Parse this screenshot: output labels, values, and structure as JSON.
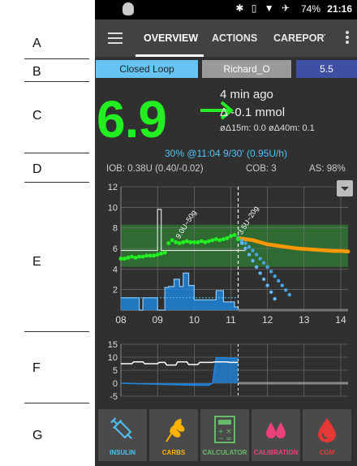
{
  "annotations": [
    "A",
    "B",
    "C",
    "D",
    "E",
    "F",
    "G"
  ],
  "status_bar": {
    "time": "21:16",
    "battery": "74%",
    "icons": "✱ ▯ ▼ ✈"
  },
  "toolbar": {
    "tabs": [
      {
        "label": "OVERVIEW",
        "active": true
      },
      {
        "label": "ACTIONS",
        "active": false
      },
      {
        "label": "CAREPORT",
        "active": false
      }
    ]
  },
  "top_buttons": {
    "loop_mode": "Closed Loop",
    "profile": "Richard_O",
    "target": "5.5"
  },
  "bg": {
    "value": "6.9",
    "trend_arrow": "→",
    "ago": "4 min ago",
    "delta": "Δ -0.1 mmol",
    "avg_delta": "øΔ15m: 0.0  øΔ40m: 0.1",
    "color": "#22ee22"
  },
  "temp_basal": "30% @11:04 9/30' (0.95U/h)",
  "iob_cob": {
    "iob": "IOB: 0.38U (0.40/-0.02)",
    "cob": "COB: 3",
    "as": "AS: 98%"
  },
  "colors": {
    "bg_point": "#22ee22",
    "prediction_iob": "#4aa3df",
    "prediction_cob": "#ff9800",
    "basal": "#1e88e5",
    "target_band": "#2e7d32"
  },
  "chart_data": [
    {
      "type": "line",
      "title": "",
      "x_tick_labels": [
        "08",
        "09",
        "10",
        "11",
        "12",
        "13",
        "14"
      ],
      "y_tick_labels": [
        "2",
        "4",
        "6",
        "8",
        "10",
        "12"
      ],
      "ylim": [
        0,
        12
      ],
      "xlim": [
        8.0,
        14.2
      ],
      "target_range": [
        4.2,
        8.3
      ],
      "now": 11.2,
      "bg": {
        "x": [
          8.0,
          8.1,
          8.2,
          8.3,
          8.4,
          8.5,
          8.6,
          8.7,
          8.8,
          8.9,
          9.0,
          9.1,
          9.2,
          9.3,
          9.4,
          9.5,
          9.6,
          9.7,
          9.8,
          9.9,
          10.0,
          10.1,
          10.2,
          10.3,
          10.4,
          10.5,
          10.6,
          10.7,
          10.8,
          10.9,
          11.0,
          11.1,
          11.2
        ],
        "y": [
          5.0,
          5.0,
          5.1,
          5.2,
          5.1,
          5.2,
          5.2,
          5.3,
          5.3,
          5.3,
          5.4,
          5.5,
          5.6,
          6.5,
          6.8,
          6.6,
          6.5,
          6.6,
          6.7,
          6.6,
          6.6,
          6.6,
          6.7,
          6.6,
          6.7,
          6.8,
          6.9,
          6.8,
          6.9,
          7.0,
          7.2,
          7.3,
          6.9
        ]
      },
      "prediction_cob": {
        "x": [
          11.2,
          11.4,
          11.6,
          11.8,
          12.0,
          12.2,
          12.4,
          12.6,
          12.8,
          13.0,
          13.2,
          13.4,
          13.6,
          13.8,
          14.0,
          14.2
        ],
        "y": [
          7.0,
          6.9,
          6.8,
          6.6,
          6.4,
          6.3,
          6.2,
          6.1,
          6.0,
          5.95,
          5.9,
          5.85,
          5.8,
          5.75,
          5.75,
          5.7
        ]
      },
      "prediction_iob_a": {
        "x": [
          11.2,
          11.4,
          11.6,
          11.8,
          12.0,
          12.2
        ],
        "y": [
          7.0,
          6.0,
          4.8,
          3.6,
          2.4,
          1.1
        ]
      },
      "prediction_iob_b": {
        "x": [
          11.2,
          11.4,
          11.6,
          11.8,
          12.0,
          12.2,
          12.4,
          12.6
        ],
        "y": [
          7.0,
          6.5,
          5.8,
          5.0,
          4.2,
          3.3,
          2.4,
          1.5
        ]
      },
      "profile_target": {
        "x": [
          8.0,
          9.0,
          9.0,
          9.1,
          9.1,
          9.5,
          9.5,
          11.4
        ],
        "y": [
          5.8,
          5.8,
          9.8,
          9.8,
          5.8,
          5.8,
          5.8,
          5.8
        ]
      },
      "basal": {
        "x": [
          8.0,
          8.5,
          8.5,
          8.6,
          8.6,
          9.0,
          9.0,
          9.2,
          9.2,
          9.3,
          9.3,
          9.45,
          9.45,
          9.6,
          9.6,
          9.7,
          9.7,
          9.85,
          9.85,
          10.0,
          10.0,
          10.6,
          10.6,
          10.8,
          10.8,
          11.1,
          11.1,
          11.2
        ],
        "y": [
          1.2,
          1.2,
          0.0,
          0.0,
          1.2,
          1.2,
          0.0,
          0.0,
          2.2,
          2.2,
          2.3,
          2.3,
          3.0,
          3.0,
          2.3,
          2.3,
          3.6,
          3.6,
          2.4,
          2.4,
          1.0,
          1.0,
          1.9,
          1.9,
          0.8,
          0.8,
          0.3,
          0.3
        ]
      },
      "annotations": [
        {
          "label": "9.0U~50g",
          "x": 9.6,
          "y": 6.9
        },
        {
          "label": "3.5U~20g",
          "x": 11.3,
          "y": 7.3
        }
      ]
    },
    {
      "type": "line",
      "title": "",
      "y_tick_labels": [
        "15",
        "10",
        "5",
        "0",
        "-5"
      ],
      "ylim": [
        -5,
        15
      ],
      "xlim": [
        8.0,
        14.2
      ],
      "now": 11.2,
      "iob_white": {
        "x": [
          8.0,
          8.3,
          8.35,
          8.6,
          8.65,
          9.0,
          9.05,
          9.2,
          9.25,
          9.5,
          9.55,
          9.8,
          9.85,
          10.1,
          10.15,
          10.5,
          10.55,
          10.9,
          10.95,
          11.2
        ],
        "y": [
          7.5,
          7.5,
          8.2,
          8.2,
          7.5,
          7.5,
          8.0,
          8.0,
          7.0,
          7.0,
          8.2,
          8.2,
          7.2,
          7.2,
          8.0,
          8.0,
          8.2,
          8.2,
          8.0,
          8.0
        ]
      },
      "activity_blue": {
        "x": [
          8.0,
          8.5,
          9.0,
          9.5,
          10.0,
          10.4,
          10.5,
          10.6,
          11.2
        ],
        "y": [
          0.0,
          -0.2,
          -0.4,
          -0.6,
          -0.8,
          -0.8,
          0.0,
          9.8,
          9.6
        ]
      }
    }
  ],
  "actions": [
    {
      "label": "INSULIN",
      "icon": "syringe-icon",
      "color": "#4fc3f7"
    },
    {
      "label": "CARBS",
      "icon": "wheat-icon",
      "color": "#ffb300"
    },
    {
      "label": "CALCULATOR",
      "icon": "calculator-icon",
      "color": "#66bb6a"
    },
    {
      "label": "CALIBRATION",
      "icon": "drops-icon",
      "color": "#ec407a"
    },
    {
      "label": "CGM",
      "icon": "drop-icon",
      "color": "#e53935"
    }
  ]
}
